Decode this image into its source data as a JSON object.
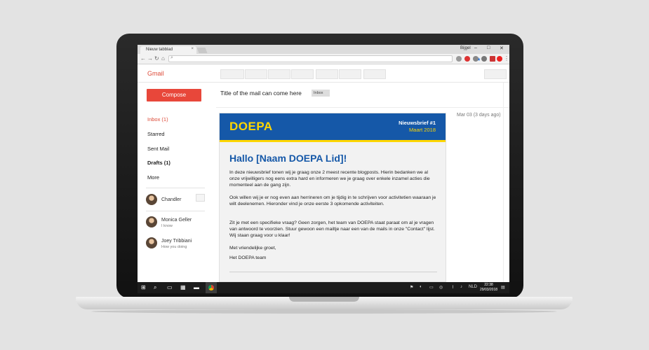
{
  "browser": {
    "tab_title": "Nieuw tabblad",
    "tab_close": "×",
    "user": "Bijgel",
    "window_minimize": "–",
    "window_maximize": "□",
    "window_close": "✕"
  },
  "gmail": {
    "logo": "Gmail",
    "compose": "Compose",
    "nav": [
      {
        "label": "Inbox (1)"
      },
      {
        "label": "Starred"
      },
      {
        "label": "Sent Mail"
      },
      {
        "label": "Drafts (1)"
      },
      {
        "label": "More"
      }
    ],
    "contacts": [
      {
        "name": "Chandler",
        "status": ""
      },
      {
        "name": "Monica Geller",
        "status": "I know"
      },
      {
        "name": "Joey Tribbiani",
        "status": "How you doing"
      }
    ]
  },
  "mail": {
    "subject": "Title of the mail can come here",
    "badge": "Inbox",
    "date": "Mar 03 (3 days ago)"
  },
  "newsletter": {
    "brand": "DOEPA",
    "issue": "Nieuwsbrief #1",
    "month": "Maart 2018",
    "greeting": "Hallo [Naam DOEPA Lid]!",
    "paragraphs": [
      "In deze nieuwsbrief tonen wij je graag onze 2 meest recente blogposts. Hierin bedanken we al onze vrijwilligers nog eens extra hard en informeren we je graag over enkele inzamel acties die momenteel aan de gang zijn.",
      "Ook willen wij je er nog even aan herrineren om je tijdig in te schrijven voor activitetien waaraan je wilt deelenemen. Hieronder vind je onze eerste 3 opkomende activiteiten.",
      "Zit je met een specifieke vraag? Geen zorgen, het team van DOEPA staat paraat om al je vragen van antwoord te voorzien. Stuur gewoon een mailtje naar een van de mails in onze \"Contact\" lijst. Wij staan graag voor u klaar!",
      "Met vriendelijke groet,",
      "Het DOEPA team"
    ]
  },
  "taskbar": {
    "language": "NLD",
    "time": "22:38",
    "date": "29/03/2018"
  },
  "colors": {
    "gmail_red": "#dd4b39",
    "compose_red": "#e8473a",
    "doepa_blue": "#1558a8",
    "doepa_yellow": "#ffd600"
  }
}
